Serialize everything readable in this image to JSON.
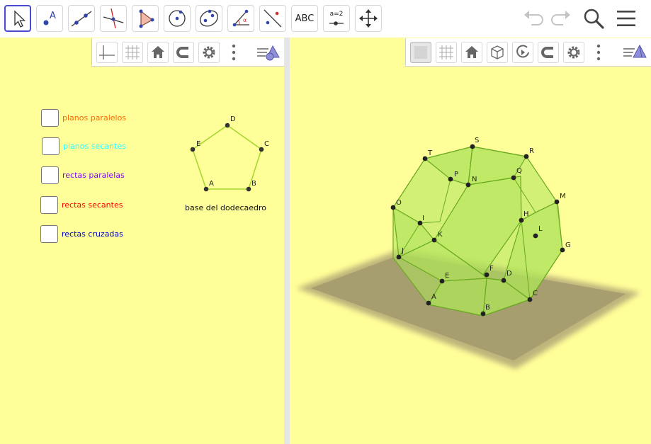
{
  "toolbar": {
    "text_tool_label": "ABC",
    "slider_tool_label": "a=2"
  },
  "left_view": {
    "checkboxes": [
      {
        "label": "planos paralelos",
        "color": "#ff6600"
      },
      {
        "label": "planos secantes",
        "color": "#33ffff"
      },
      {
        "label": "rectas paralelas",
        "color": "#7f00ff"
      },
      {
        "label": "rectas secantes",
        "color": "#ff0000"
      },
      {
        "label": "rectas cruzadas",
        "color": "#0000cc"
      }
    ],
    "pentagon_points": [
      "D",
      "E",
      "C",
      "A",
      "B"
    ],
    "caption": "base del dodecaedro"
  },
  "right_view": {
    "point_labels": [
      "S",
      "T",
      "R",
      "P",
      "N",
      "Q",
      "M",
      "O",
      "H",
      "I",
      "L",
      "K",
      "G",
      "J",
      "F",
      "E",
      "D",
      "A",
      "C",
      "B"
    ]
  },
  "colors": {
    "canvas_background": "#ffff99",
    "active_tool_border": "#4a4ad0",
    "dodecahedron_fill": "#aee35a",
    "dodecahedron_edge": "#6aaa20"
  }
}
